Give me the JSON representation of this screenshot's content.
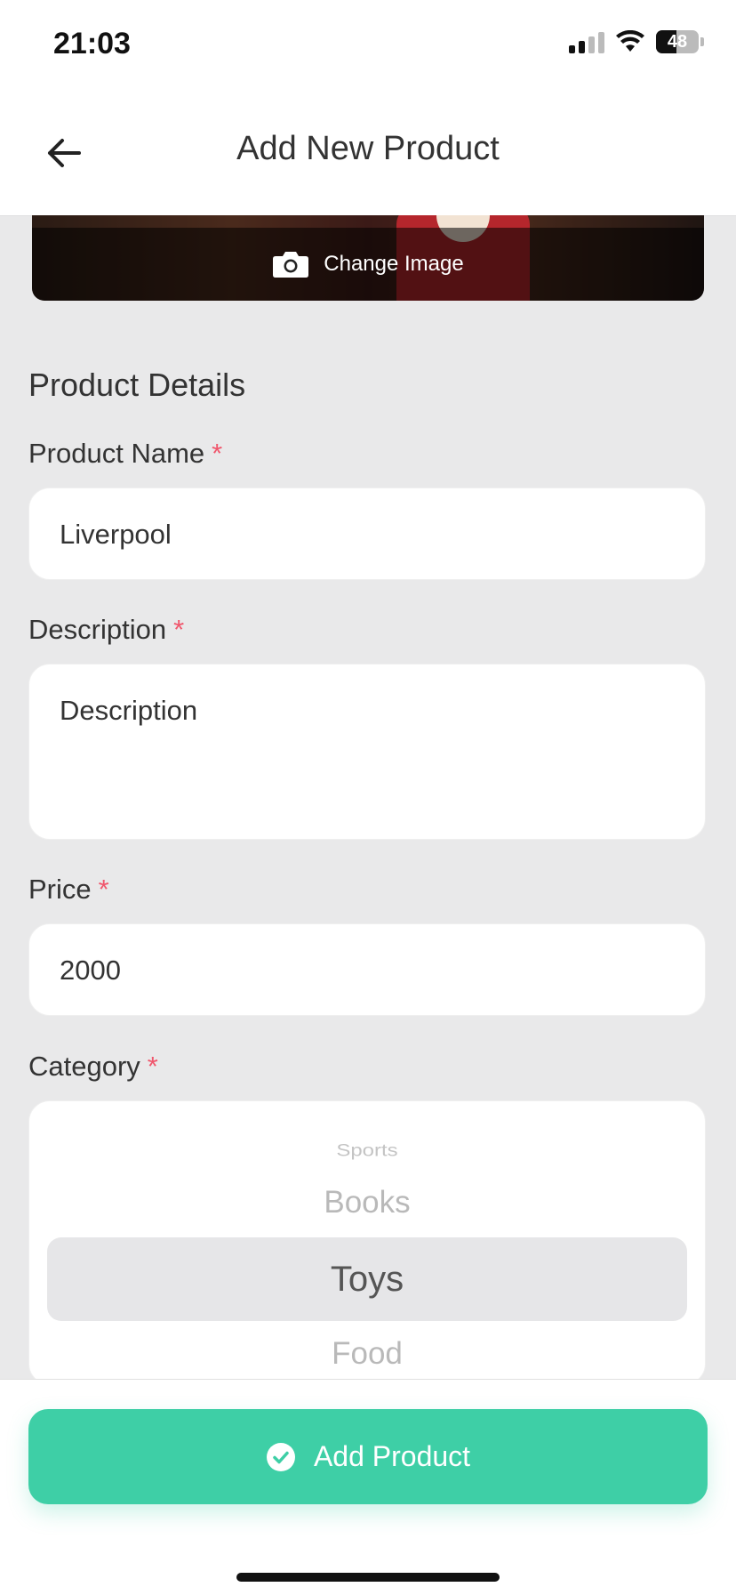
{
  "status_bar": {
    "time": "21:03",
    "battery": "48"
  },
  "header": {
    "title": "Add New Product",
    "back_icon": "arrow-left-icon"
  },
  "image": {
    "change_label": "Change Image",
    "icon": "camera-icon"
  },
  "form": {
    "section_title": "Product Details",
    "required_mark": "*",
    "name": {
      "label": "Product Name",
      "value": "Liverpool"
    },
    "description": {
      "label": "Description",
      "placeholder": "Description"
    },
    "price": {
      "label": "Price",
      "value": "2000"
    },
    "category": {
      "label": "Category",
      "options": [
        "Sports",
        "Books",
        "Toys",
        "Food"
      ],
      "selected": "Toys"
    }
  },
  "actions": {
    "add_product_label": "Add Product",
    "icon": "check-circle-icon"
  },
  "colors": {
    "accent": "#3ecfa6",
    "required": "#f0566c",
    "background": "#e9e9ea"
  }
}
